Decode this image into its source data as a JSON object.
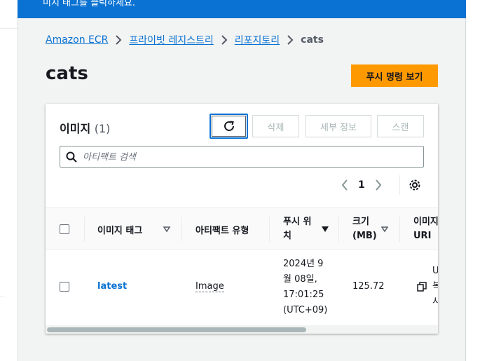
{
  "flash": {
    "message": "미지 태그를 클릭하세요."
  },
  "breadcrumb": {
    "items": [
      "Amazon ECR",
      "프라이빗 레지스트리",
      "리포지토리"
    ],
    "current": "cats"
  },
  "page": {
    "title": "cats",
    "push_button": "푸시 명령 보기"
  },
  "images": {
    "title": "이미지",
    "count": "(1)",
    "buttons": {
      "delete": "삭제",
      "details": "세부 정보",
      "scan": "스캔"
    },
    "search_placeholder": "아티팩트 검색",
    "pagination": {
      "current_page": "1"
    },
    "columns": {
      "tag": "이미지 태그",
      "artifact_type": "아티팩트 유형",
      "pushed_at_1": "푸시 위",
      "pushed_at_2": "치",
      "size_1": "크기",
      "size_2": "(MB)",
      "uri_1": "이미지",
      "uri_2": "URI"
    },
    "rows": [
      {
        "tag": "latest",
        "artifact_type": "Image",
        "pushed_at_lines": [
          "2024년 9",
          "월 08일,",
          "17:01:25",
          "(UTC+09)"
        ],
        "size": "125.72",
        "uri_lines": [
          "U",
          "복",
          "시"
        ]
      }
    ]
  },
  "colors": {
    "accent": "#0972d3",
    "primary_button": "#ff9900"
  }
}
